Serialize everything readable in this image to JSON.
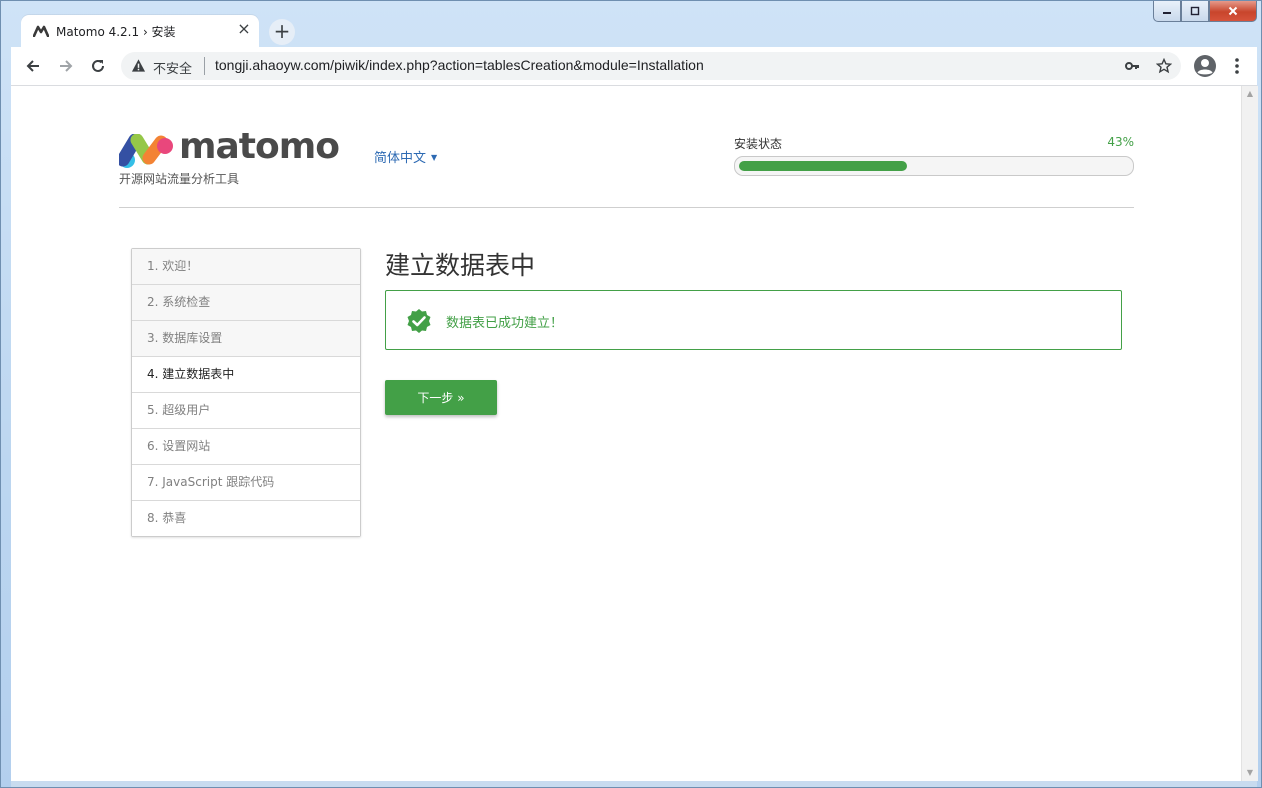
{
  "browser": {
    "tab_title": "Matomo 4.2.1 › 安装",
    "tab_close": "×",
    "new_tab": "+",
    "security_label": "不安全",
    "url": "tongji.ahaoyw.com/piwik/index.php?action=tablesCreation&module=Installation",
    "icons": {
      "back": "back-arrow-icon",
      "forward": "forward-arrow-icon",
      "reload": "reload-icon",
      "warning": "warning-triangle-icon",
      "key": "key-icon",
      "star": "star-icon",
      "profile": "profile-icon",
      "menu": "menu-dots-icon"
    }
  },
  "header": {
    "logo_text": "matomo",
    "tagline": "开源网站流量分析工具",
    "language": "简体中文",
    "progress_label": "安装状态",
    "progress_percent_text": "43%",
    "progress_value": 43
  },
  "steps": [
    {
      "label": "1. 欢迎！",
      "state": "done"
    },
    {
      "label": "2. 系统检查",
      "state": "done"
    },
    {
      "label": "3. 数据库设置",
      "state": "done"
    },
    {
      "label": "4. 建立数据表中",
      "state": "current"
    },
    {
      "label": "5. 超级用户",
      "state": "upcoming"
    },
    {
      "label": "6. 设置网站",
      "state": "upcoming"
    },
    {
      "label": "7. JavaScript 跟踪代码",
      "state": "upcoming"
    },
    {
      "label": "8. 恭喜",
      "state": "upcoming"
    }
  ],
  "main": {
    "title": "建立数据表中",
    "success_message": "数据表已成功建立！",
    "next_button": "下一步 »"
  },
  "colors": {
    "accent_green": "#43a047",
    "link_blue": "#2d6ab3"
  }
}
